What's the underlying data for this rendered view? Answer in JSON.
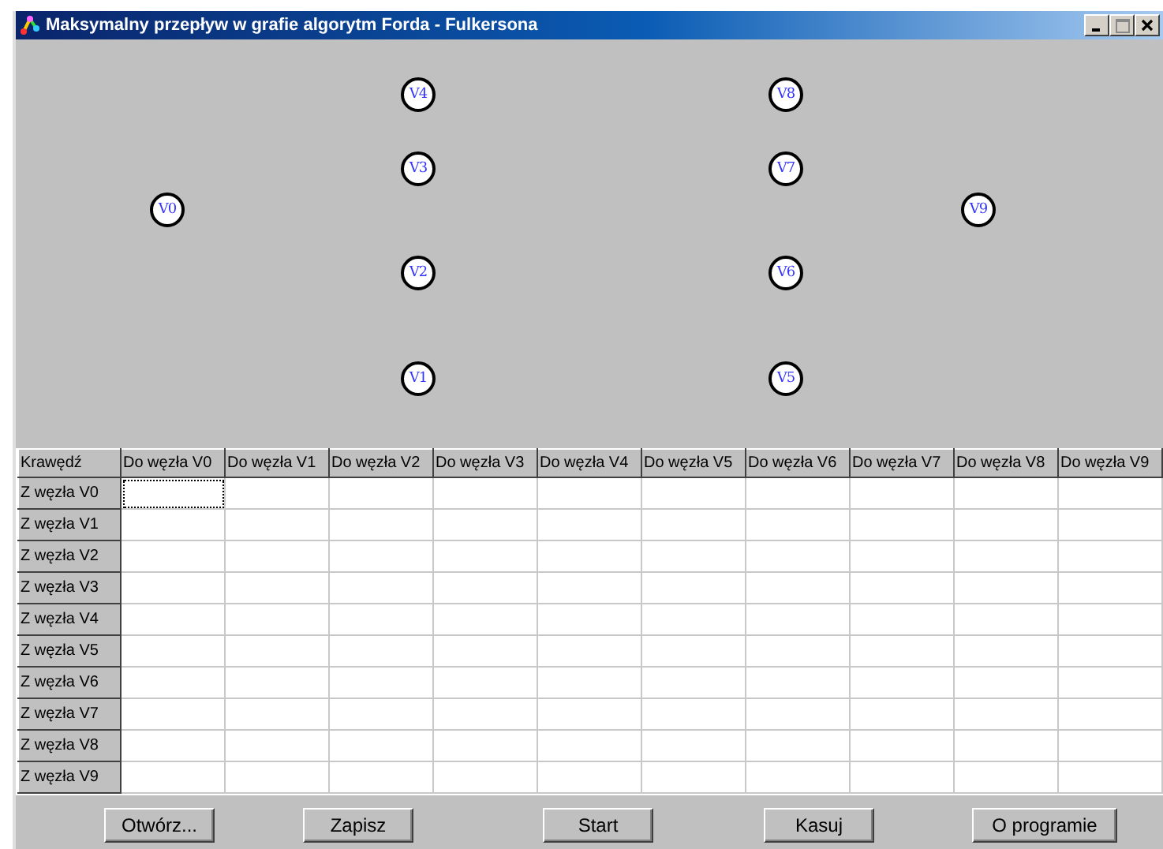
{
  "window": {
    "title": "Maksymalny przepływ w grafie algorytm Forda - Fulkersona"
  },
  "graph": {
    "columns": [
      {
        "nodes": [
          "V0"
        ]
      },
      {
        "nodes": [
          "V4",
          "V3",
          "V2",
          "V1"
        ]
      },
      {
        "nodes": [
          "V8",
          "V7",
          "V6",
          "V5"
        ]
      },
      {
        "nodes": [
          "V9"
        ]
      }
    ]
  },
  "table": {
    "corner": "Krawędź",
    "columns": [
      "Do węzła V0",
      "Do węzła V1",
      "Do węzła V2",
      "Do węzła V3",
      "Do węzła V4",
      "Do węzła V5",
      "Do węzła V6",
      "Do węzła V7",
      "Do węzła V8",
      "Do węzła V9"
    ],
    "rows": [
      {
        "label": "Z węzła V0",
        "cells": [
          {
            "selected": true
          },
          {
            "selected": false
          },
          {
            "selected": false
          },
          {
            "selected": false
          },
          {
            "selected": false
          },
          {
            "selected": false
          },
          {
            "selected": false
          },
          {
            "selected": false
          },
          {
            "selected": false
          },
          {
            "selected": false
          }
        ]
      },
      {
        "label": "Z węzła V1",
        "cells": [
          {
            "selected": false
          },
          {
            "selected": false
          },
          {
            "selected": false
          },
          {
            "selected": false
          },
          {
            "selected": false
          },
          {
            "selected": false
          },
          {
            "selected": false
          },
          {
            "selected": false
          },
          {
            "selected": false
          },
          {
            "selected": false
          }
        ]
      },
      {
        "label": "Z węzła V2",
        "cells": [
          {
            "selected": false
          },
          {
            "selected": false
          },
          {
            "selected": false
          },
          {
            "selected": false
          },
          {
            "selected": false
          },
          {
            "selected": false
          },
          {
            "selected": false
          },
          {
            "selected": false
          },
          {
            "selected": false
          },
          {
            "selected": false
          }
        ]
      },
      {
        "label": "Z węzła V3",
        "cells": [
          {
            "selected": false
          },
          {
            "selected": false
          },
          {
            "selected": false
          },
          {
            "selected": false
          },
          {
            "selected": false
          },
          {
            "selected": false
          },
          {
            "selected": false
          },
          {
            "selected": false
          },
          {
            "selected": false
          },
          {
            "selected": false
          }
        ]
      },
      {
        "label": "Z węzła V4",
        "cells": [
          {
            "selected": false
          },
          {
            "selected": false
          },
          {
            "selected": false
          },
          {
            "selected": false
          },
          {
            "selected": false
          },
          {
            "selected": false
          },
          {
            "selected": false
          },
          {
            "selected": false
          },
          {
            "selected": false
          },
          {
            "selected": false
          }
        ]
      },
      {
        "label": "Z węzła V5",
        "cells": [
          {
            "selected": false
          },
          {
            "selected": false
          },
          {
            "selected": false
          },
          {
            "selected": false
          },
          {
            "selected": false
          },
          {
            "selected": false
          },
          {
            "selected": false
          },
          {
            "selected": false
          },
          {
            "selected": false
          },
          {
            "selected": false
          }
        ]
      },
      {
        "label": "Z węzła V6",
        "cells": [
          {
            "selected": false
          },
          {
            "selected": false
          },
          {
            "selected": false
          },
          {
            "selected": false
          },
          {
            "selected": false
          },
          {
            "selected": false
          },
          {
            "selected": false
          },
          {
            "selected": false
          },
          {
            "selected": false
          },
          {
            "selected": false
          }
        ]
      },
      {
        "label": "Z węzła V7",
        "cells": [
          {
            "selected": false
          },
          {
            "selected": false
          },
          {
            "selected": false
          },
          {
            "selected": false
          },
          {
            "selected": false
          },
          {
            "selected": false
          },
          {
            "selected": false
          },
          {
            "selected": false
          },
          {
            "selected": false
          },
          {
            "selected": false
          }
        ]
      },
      {
        "label": "Z węzła V8",
        "cells": [
          {
            "selected": false
          },
          {
            "selected": false
          },
          {
            "selected": false
          },
          {
            "selected": false
          },
          {
            "selected": false
          },
          {
            "selected": false
          },
          {
            "selected": false
          },
          {
            "selected": false
          },
          {
            "selected": false
          },
          {
            "selected": false
          }
        ]
      },
      {
        "label": "Z węzła V9",
        "cells": [
          {
            "selected": false
          },
          {
            "selected": false
          },
          {
            "selected": false
          },
          {
            "selected": false
          },
          {
            "selected": false
          },
          {
            "selected": false
          },
          {
            "selected": false
          },
          {
            "selected": false
          },
          {
            "selected": false
          },
          {
            "selected": false
          }
        ]
      }
    ]
  },
  "buttons": [
    "Otwórz...",
    "Zapisz",
    "Start",
    "Kasuj",
    "O programie"
  ]
}
